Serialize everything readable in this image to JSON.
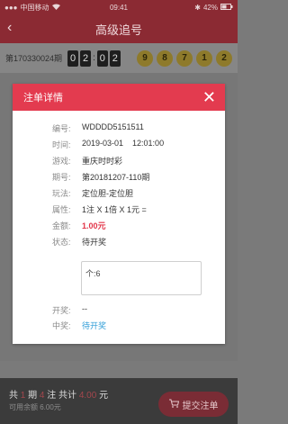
{
  "status_bar": {
    "carrier": "中国移动",
    "time": "09:41",
    "battery": "42%"
  },
  "nav": {
    "title": "高级追号"
  },
  "draw": {
    "issue": "第170330024期",
    "countdown": [
      "0",
      "2",
      "0",
      "2"
    ],
    "numbers": [
      "9",
      "8",
      "7",
      "1",
      "2"
    ]
  },
  "modal": {
    "title": "注单详情",
    "fields": [
      {
        "label": "编号:",
        "value": "WDDDD5151511"
      },
      {
        "label": "时间:",
        "value": "2019-03-01    12:01:00"
      },
      {
        "label": "游戏:",
        "value": "重庆时时彩"
      },
      {
        "label": "期号:",
        "value": "第20181207-110期"
      },
      {
        "label": "玩法:",
        "value": "定位胆-定位胆"
      },
      {
        "label": "属性:",
        "value": "1注 X 1倍 X 1元 ="
      },
      {
        "label": "金额:",
        "value": "1.00元"
      },
      {
        "label": "状态:",
        "value": "待开奖"
      }
    ],
    "note": "个:6",
    "draw_result": {
      "label": "开奖:",
      "value": "--"
    },
    "win": {
      "label": "中奖:",
      "value": "待开奖"
    }
  },
  "bottom": {
    "summary_prefix": "共",
    "periods": "1",
    "periods_suffix": "期",
    "bets": "4",
    "bets_suffix": "注  共计",
    "amount": "4.00",
    "amount_suffix": "元",
    "balance": "可用余额 6.00元",
    "submit_label": "提交注单"
  },
  "colors": {
    "accent": "#e33b4f",
    "link": "#2e9cd7"
  }
}
